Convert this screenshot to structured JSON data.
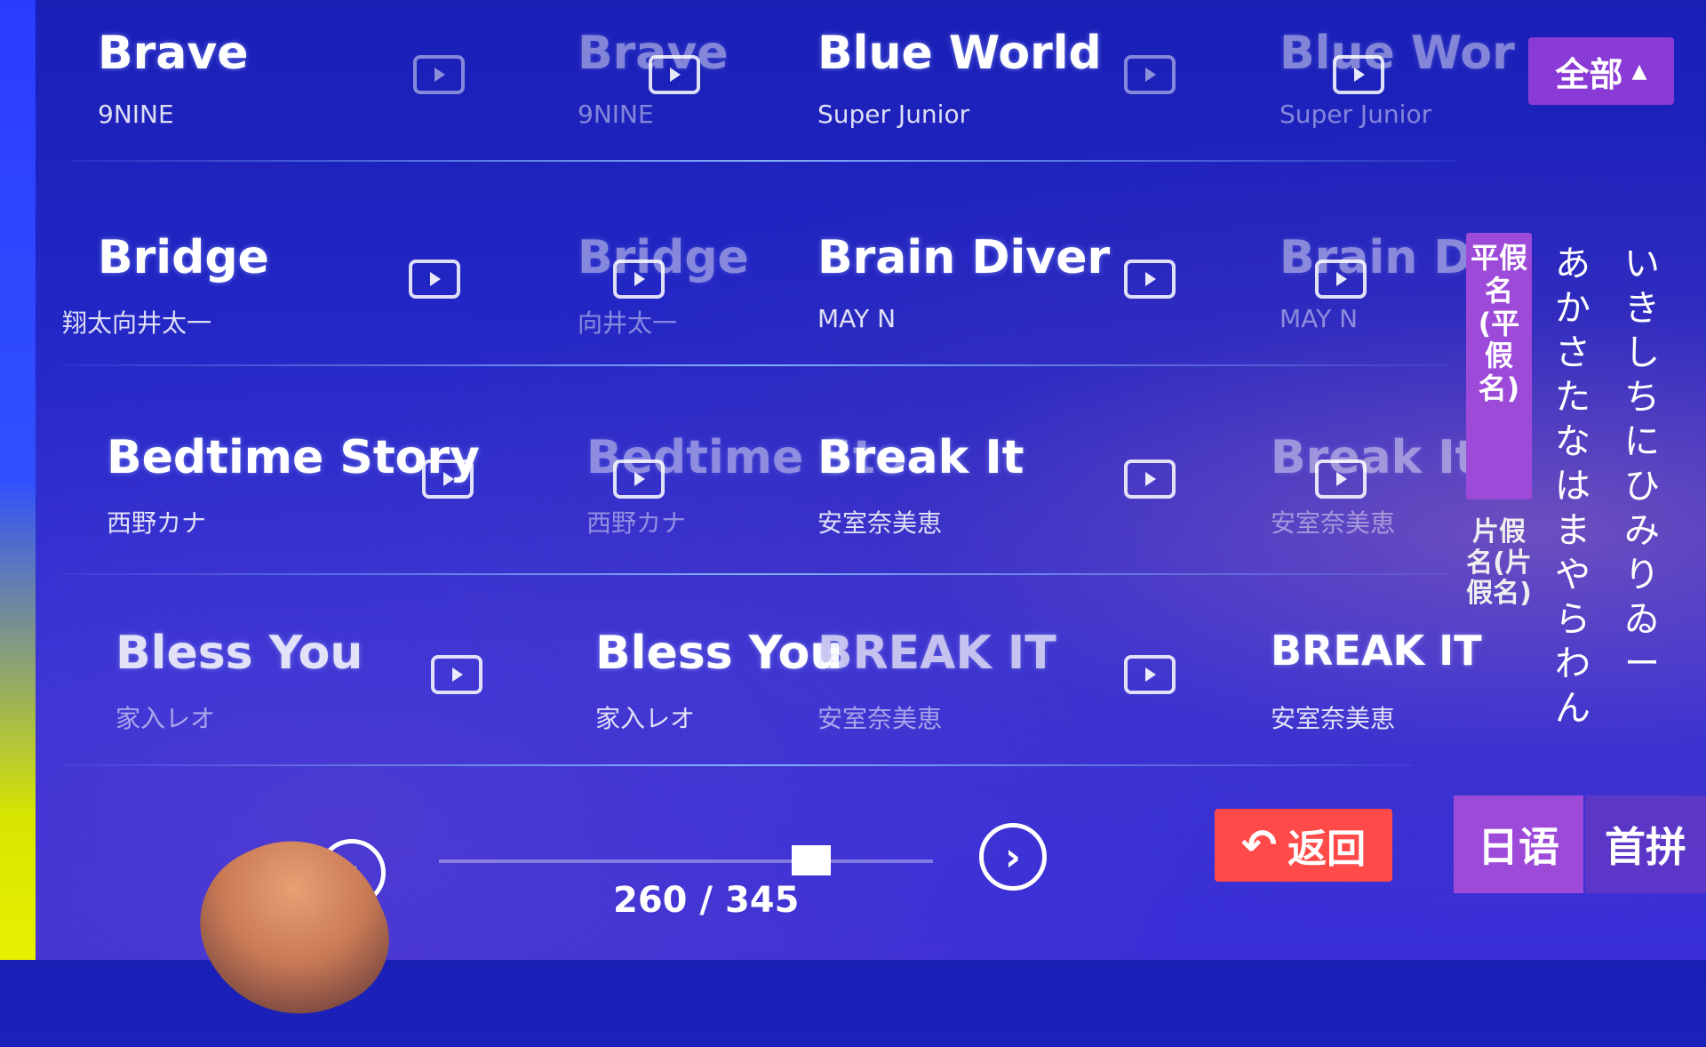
{
  "filter": {
    "label": "全部",
    "caret": "▲"
  },
  "songs": [
    {
      "title": "Brave",
      "artist": "9NINE"
    },
    {
      "title": "Brave",
      "artist": "9NINE"
    },
    {
      "title": "Blue World",
      "artist": "Super Junior"
    },
    {
      "title": "Blue Wor",
      "artist": "Super Junior"
    },
    {
      "title": "Bridge",
      "artist": "翔太向井太一"
    },
    {
      "title": "Bridge",
      "artist": "向井太一"
    },
    {
      "title": "Brain Diver",
      "artist": "MAY N"
    },
    {
      "title": "Brain Div",
      "artist": "MAY N"
    },
    {
      "title": "Bedtime Story",
      "artist": "西野カナ"
    },
    {
      "title": "Bedtime Sto",
      "artist": "西野カナ"
    },
    {
      "title": "Break It",
      "artist": "安室奈美恵"
    },
    {
      "title": "Break It",
      "artist": "安室奈美恵"
    },
    {
      "title": "Bless You",
      "artist": "家入レオ"
    },
    {
      "title": "Bless You",
      "artist": "家入レオ"
    },
    {
      "title": "BREAK IT",
      "artist": "安室奈美恵"
    },
    {
      "title": "BREAK IT",
      "artist": "安室奈美恵"
    }
  ],
  "kana": {
    "tab_hiragana": "平假名(平假名)",
    "tab_katakana": "片假名(片假名)",
    "column1": "あかさたなはまやらわん",
    "column2": "いきしちにひみりゐー"
  },
  "bottom": {
    "back_label": "返回",
    "back_icon": "↶",
    "tab_japanese": "日语",
    "tab_pinyin": "首拼",
    "page_current": "260",
    "page_total": "345",
    "page_text": "260 / 345",
    "page_progress": 0.754,
    "prev_icon": "chevron-left-icon",
    "next_icon": "chevron-right-icon"
  },
  "colors": {
    "accent": "#9d4ad9",
    "back_button": "#ff4a4a",
    "background": "#2428c8"
  }
}
